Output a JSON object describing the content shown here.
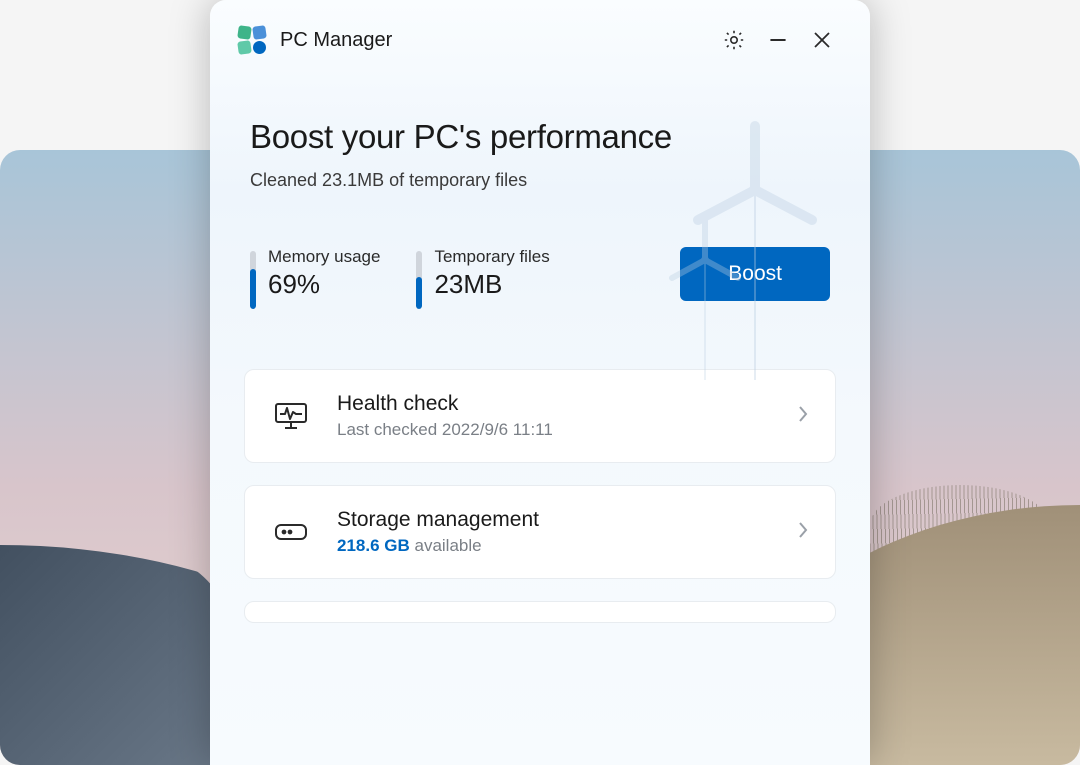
{
  "app": {
    "title": "PC Manager"
  },
  "hero": {
    "title": "Boost your PC's performance",
    "subtitle": "Cleaned 23.1MB of temporary files"
  },
  "metrics": {
    "memory": {
      "label": "Memory usage",
      "value": "69%",
      "fill_pct": 69
    },
    "temp": {
      "label": "Temporary files",
      "value": "23MB",
      "fill_pct": 55
    }
  },
  "boost_label": "Boost",
  "cards": {
    "health": {
      "title": "Health check",
      "subtitle": "Last checked 2022/9/6 11:11"
    },
    "storage": {
      "title": "Storage management",
      "available_value": "218.6 GB",
      "available_suffix": " available"
    }
  },
  "colors": {
    "primary": "#0067c0"
  }
}
